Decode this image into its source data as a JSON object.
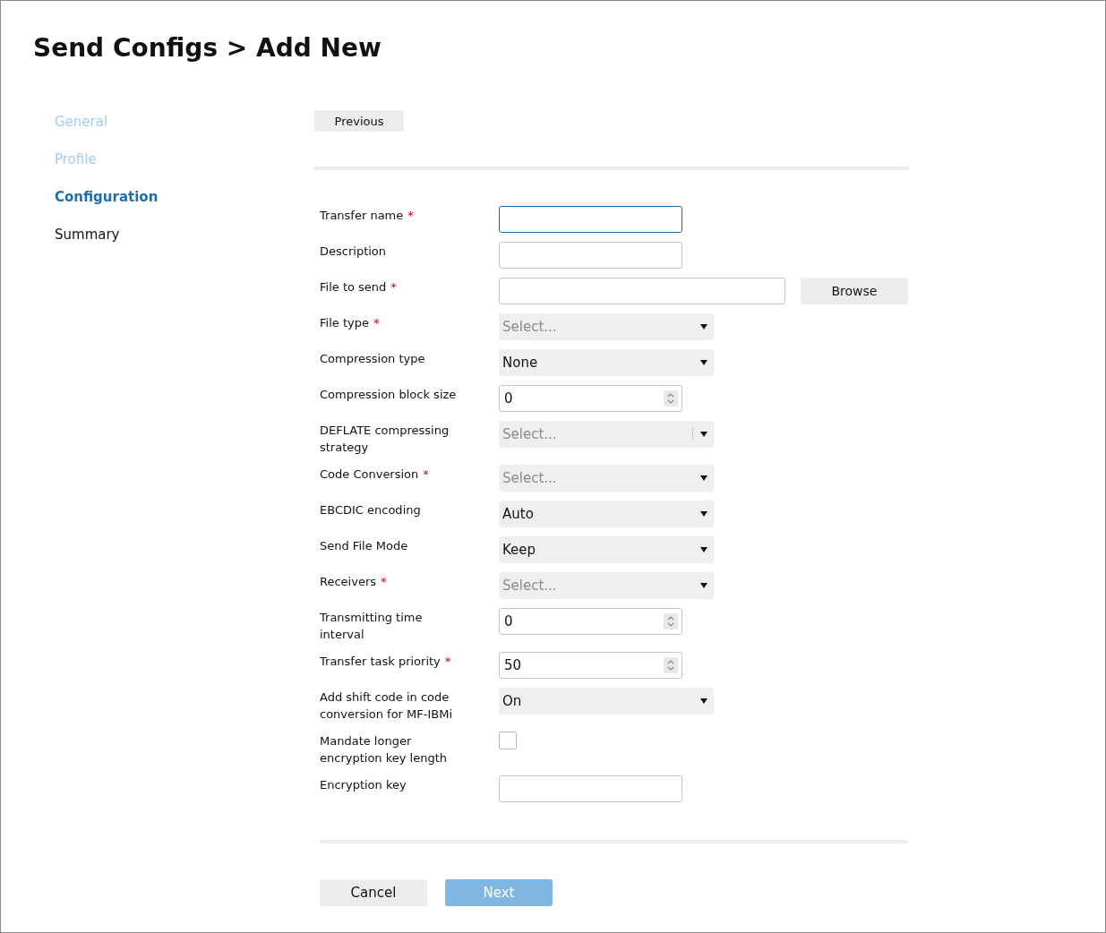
{
  "title": "Send Configs > Add New",
  "steps": [
    {
      "label": "General",
      "selected": false,
      "completed": true
    },
    {
      "label": "Profile",
      "selected": false,
      "completed": true
    },
    {
      "label": "Configuration",
      "selected": true,
      "completed": false
    },
    {
      "label": "Summary",
      "selected": false,
      "completed": false
    }
  ],
  "previous_button": "Previous",
  "required_mark": "*",
  "fields": [
    {
      "kind": "text",
      "label": "Transfer name",
      "required": true,
      "focused": true
    },
    {
      "kind": "text",
      "label": "Description",
      "required": false,
      "focused": false
    },
    {
      "kind": "file",
      "label": "File to send",
      "required": true,
      "button": "Browse"
    },
    {
      "kind": "select",
      "label": "File type",
      "required": true,
      "placeholder": "Select..."
    },
    {
      "kind": "select",
      "label": "Compression type",
      "required": false,
      "value": "None"
    },
    {
      "kind": "number",
      "label": "Compression block size",
      "required": false,
      "value": "0"
    },
    {
      "kind": "select",
      "label": "DEFLATE compressing strategy",
      "required": false,
      "placeholder": "Select...",
      "separator": true
    },
    {
      "kind": "select",
      "label": "Code Conversion",
      "required": true,
      "placeholder": "Select..."
    },
    {
      "kind": "select",
      "label": "EBCDIC encoding",
      "required": false,
      "value": "Auto"
    },
    {
      "kind": "select",
      "label": "Send File Mode",
      "required": false,
      "value": "Keep"
    },
    {
      "kind": "select",
      "label": "Receivers",
      "required": true,
      "placeholder": "Select..."
    },
    {
      "kind": "number",
      "label": "Transmitting time interval",
      "required": false,
      "value": "0"
    },
    {
      "kind": "number",
      "label": "Transfer task priority",
      "required": true,
      "value": "50"
    },
    {
      "kind": "select",
      "label": "Add shift code in code conversion for MF-IBMi",
      "required": false,
      "value": "On"
    },
    {
      "kind": "checkbox",
      "label": "Mandate longer encryption key length",
      "required": false,
      "checked": false
    },
    {
      "kind": "text",
      "label": "Encryption key",
      "required": false,
      "focused": false
    }
  ],
  "footer_buttons": [
    {
      "label": "Cancel",
      "disabled": false
    },
    {
      "label": "Next",
      "disabled": true
    }
  ]
}
